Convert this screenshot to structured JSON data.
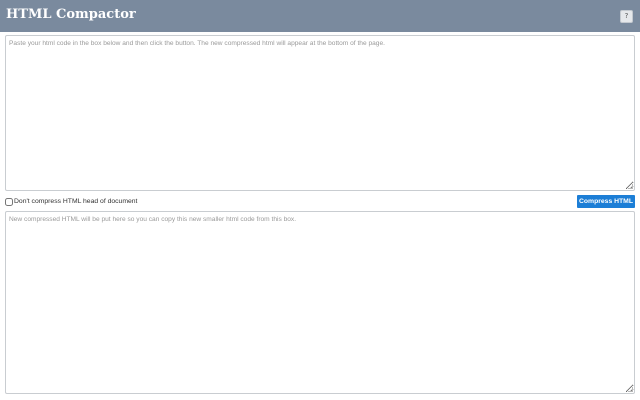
{
  "header": {
    "title": "HTML Compactor",
    "help_label": "?"
  },
  "input": {
    "placeholder": "Paste your html code in the box below and then click the button. The new compressed html will appear at the bottom of the page.",
    "value": ""
  },
  "options": {
    "dont_compress_head_label": "Don't compress HTML head of document",
    "dont_compress_head_checked": false
  },
  "actions": {
    "compress_label": "Compress HTML"
  },
  "output": {
    "placeholder": "New compressed HTML will be put here so you can copy this new smaller html code from this box.",
    "value": ""
  },
  "colors": {
    "header_bg": "#7a8a9e",
    "accent": "#1c7ed6"
  }
}
